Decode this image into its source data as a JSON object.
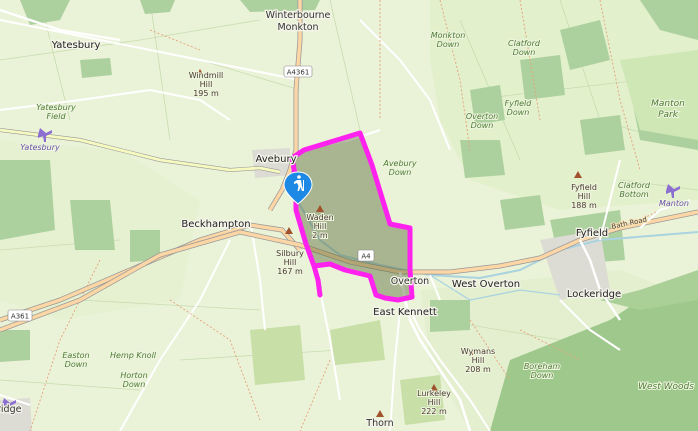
{
  "places": {
    "winterbourne_line1": "Winterbourne",
    "winterbourne_line2": "Monkton",
    "yatesbury": "Yatesbury",
    "avebury": "Avebury",
    "beckhampton": "Beckhampton",
    "overton": "Overton",
    "west_overton": "West Overton",
    "east_kennett": "East Kennett",
    "fyfield": "Fyfield",
    "lockeridge": "Lockeridge",
    "manton_line1": "Manton",
    "manton_line2": "Park",
    "thorn": "Thorn"
  },
  "hills": {
    "windmill": [
      "Windmill",
      "Hill",
      "195 m"
    ],
    "waden": [
      "Waden",
      "Hill",
      "2 m"
    ],
    "silbury": [
      "Silbury",
      "Hill",
      "167 m"
    ],
    "fyfield": [
      "Fyfield",
      "Hill",
      "188 m"
    ],
    "wymans": [
      "Wymans",
      "Hill",
      "208 m"
    ],
    "lurkeley": [
      "Lurkeley",
      "Hill",
      "222 m"
    ]
  },
  "natural": {
    "monkton_down": [
      "Monkton",
      "Down"
    ],
    "clatford_down": [
      "Clatford",
      "Down"
    ],
    "fyfield_down": [
      "Fyfield",
      "Down"
    ],
    "overton_down": [
      "Overton",
      "Down"
    ],
    "avebury_down": [
      "Avebury",
      "Down"
    ],
    "clatford_bottom": [
      "Clatford",
      "Bottom"
    ],
    "yatesbury_field": [
      "Yatesbury",
      "Field"
    ],
    "easton_down": [
      "Easton",
      "Down"
    ],
    "horton_down": [
      "Horton",
      "Down"
    ],
    "hemp_knoll": "Hemp Knoll",
    "boreham_down": [
      "Boreham",
      "Down"
    ],
    "west_woods": "West Woods"
  },
  "aerodromes": {
    "yatesbury": "Yatesbury",
    "manton": "Manton",
    "ridge_partial": "ridge"
  },
  "roads": {
    "a4361": "A4361",
    "a361": "A361",
    "a4": "A4",
    "bath_road": "Bath Road"
  },
  "route": {
    "color": "#ff22ee",
    "area_fill": "#5a6a3a"
  },
  "marker": {
    "icon": "hiker-icon",
    "color": "#1e88e5"
  }
}
